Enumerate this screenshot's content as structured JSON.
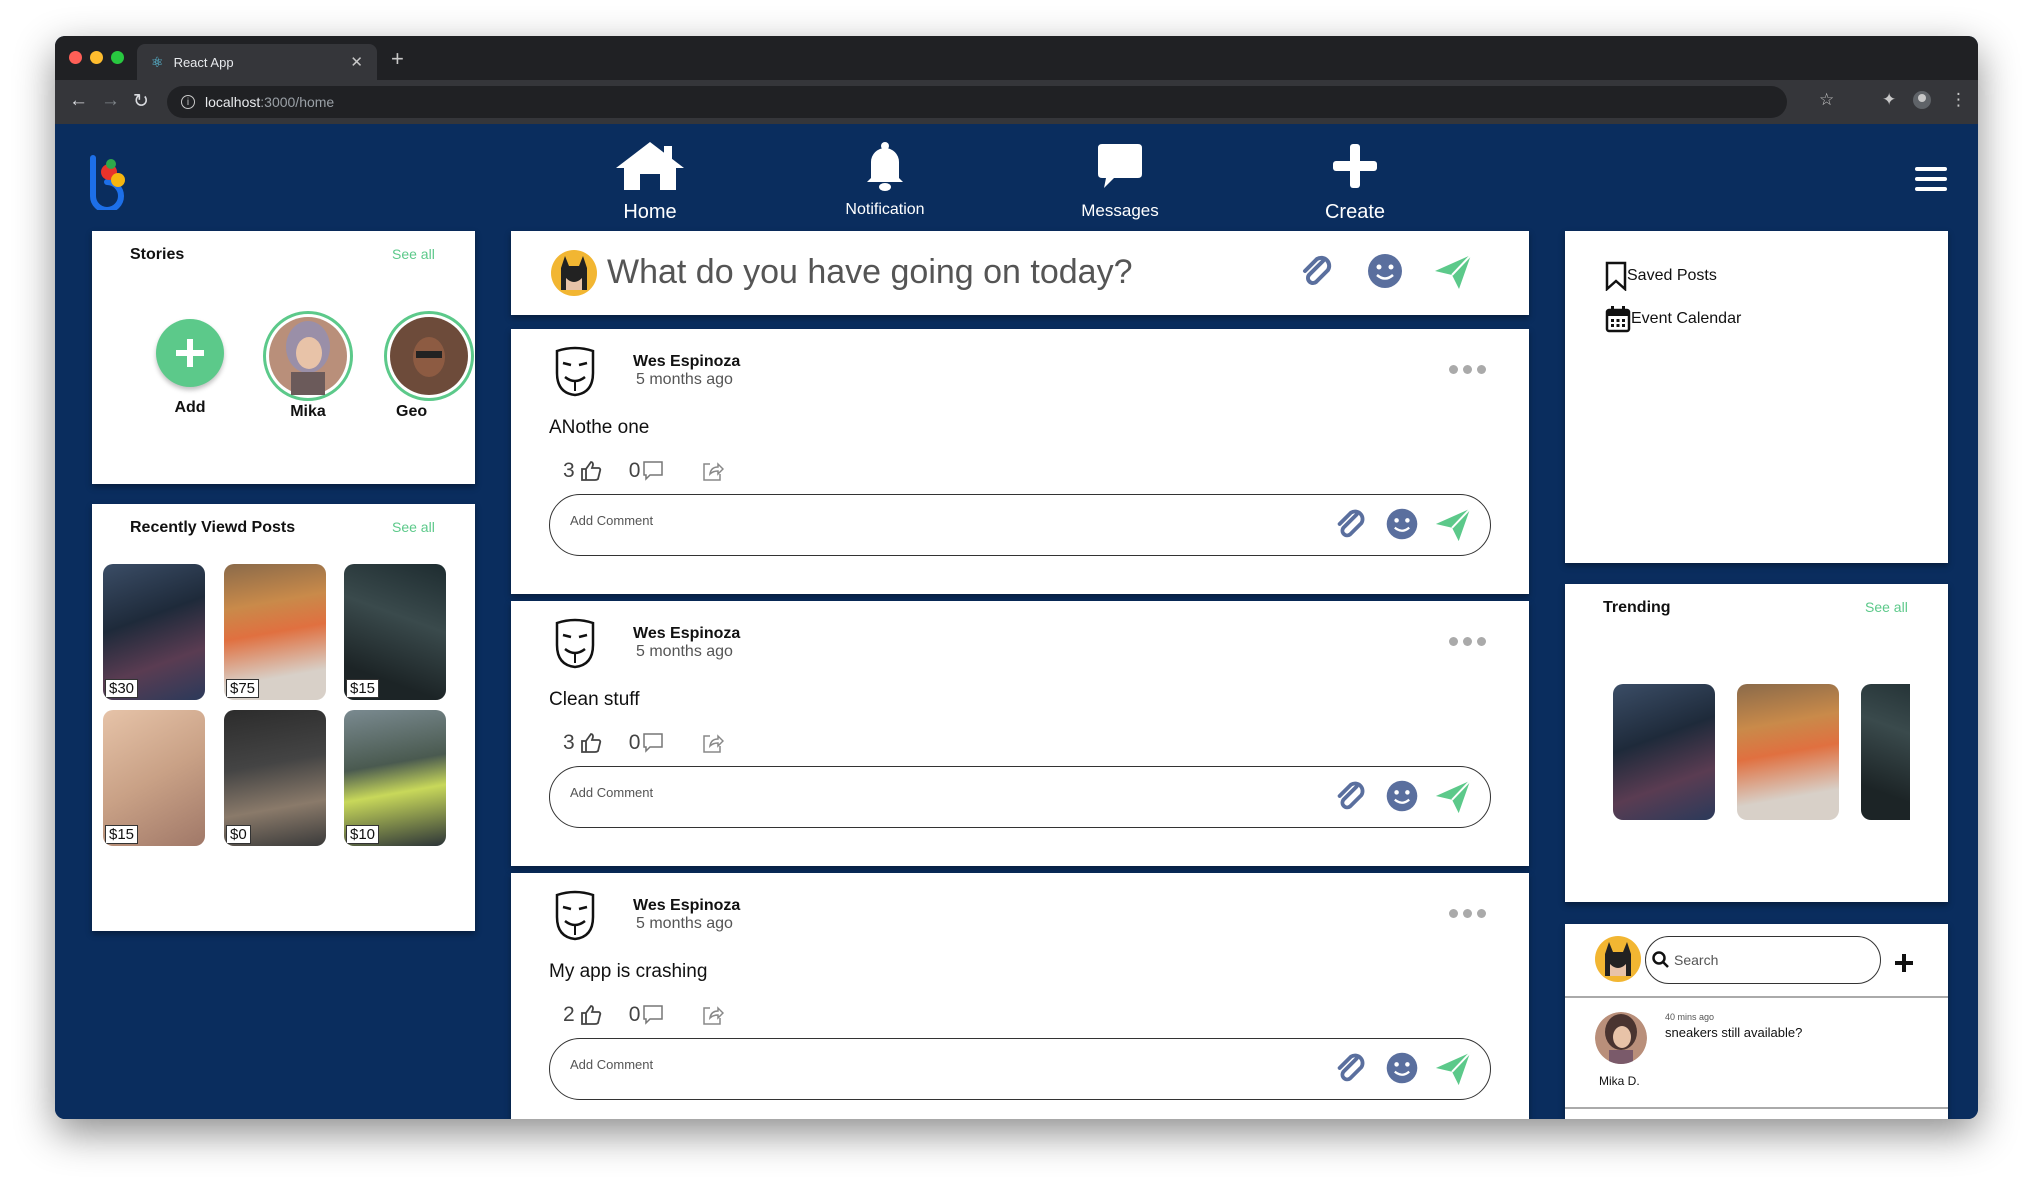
{
  "browser": {
    "tab_title": "React App",
    "url_host": "localhost",
    "url_path": ":3000/home",
    "colors": {
      "close": "#ff5f57",
      "minimize": "#febc2e",
      "maximize": "#28c840"
    }
  },
  "nav": {
    "home": "Home",
    "notification": "Notification",
    "messages": "Messages",
    "create": "Create"
  },
  "stories": {
    "title": "Stories",
    "see_all": "See all",
    "items": [
      {
        "name": "Add"
      },
      {
        "name": "Mika"
      },
      {
        "name": "Geo"
      }
    ]
  },
  "recent": {
    "title": "Recently Viewd Posts",
    "see_all": "See all",
    "prices": [
      "$30",
      "$75",
      "$15",
      "$15",
      "$0",
      "$10"
    ]
  },
  "composer": {
    "placeholder": "What do you have going on today?"
  },
  "posts": [
    {
      "author": "Wes Espinoza",
      "time": "5 months ago",
      "text": "ANothe one",
      "likes": "3",
      "comments": "0",
      "comment_placeholder": "Add Comment"
    },
    {
      "author": "Wes Espinoza",
      "time": "5 months ago",
      "text": "Clean stuff",
      "likes": "3",
      "comments": "0",
      "comment_placeholder": "Add Comment"
    },
    {
      "author": "Wes Espinoza",
      "time": "5 months ago",
      "text": "My app is crashing",
      "likes": "2",
      "comments": "0",
      "comment_placeholder": "Add Comment"
    }
  ],
  "sidebar": {
    "saved": "Saved Posts",
    "calendar": "Event Calendar"
  },
  "trending": {
    "title": "Trending",
    "see_all": "See all"
  },
  "chat": {
    "search_placeholder": "Search",
    "message": {
      "time": "40 mins ago",
      "text": "sneakers still available?",
      "sender": "Mika D."
    }
  },
  "colors": {
    "background": "#0a2d5e",
    "accent": "#5cc98a",
    "icon_blue": "#5a6f9e"
  }
}
